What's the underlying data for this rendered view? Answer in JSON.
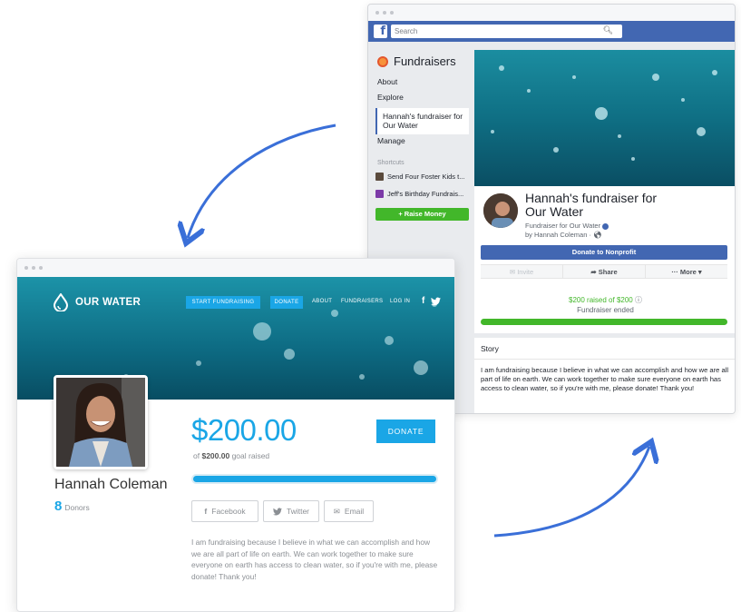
{
  "facebook": {
    "search_placeholder": "Search",
    "logo_letter": "f",
    "sidebar": {
      "title": "Fundraisers",
      "items": [
        {
          "label": "About"
        },
        {
          "label": "Explore"
        }
      ],
      "active_item": "Hannah's fundraiser for Our Water",
      "manage": "Manage",
      "shortcuts_label": "Shortcuts",
      "shortcuts": [
        {
          "label": "Send Four Foster Kids t..."
        },
        {
          "label": "Jeff's Birthday Fundrais..."
        }
      ],
      "raise_money": "+ Raise Money"
    },
    "fundraiser": {
      "title": "Hannah's fundraiser for Our Water",
      "subtitle": "Fundraiser for Our Water",
      "byline": "by Hannah Coleman · ",
      "donate_button": "Donate to Nonprofit",
      "actions": {
        "invite": "Invite",
        "share": "Share",
        "more": "More"
      },
      "raised_text": "$200 raised of $200",
      "status": "Fundraiser ended",
      "progress": 1.0
    },
    "story": {
      "heading": "Story",
      "text": "I am fundraising because I believe in what we can accomplish and how we are all part of life on earth. We can work together to make sure everyone on earth has access to clean water, so if you're with me, please donate! Thank you!"
    }
  },
  "ourwater": {
    "brand": "OUR WATER",
    "nav": {
      "start_fundraising": "START FUNDRAISING",
      "donate": "DONATE",
      "about": "ABOUT",
      "fundraisers": "FUNDRAISERS",
      "login": "LOG IN",
      "facebook_icon": "f",
      "twitter_icon": "twitter-icon"
    },
    "fundraiser": {
      "amount": "$200.00",
      "goal_prefix": "of",
      "goal_amount": "$200.00",
      "goal_suffix": "goal raised",
      "donate_button": "DONATE",
      "progress": 1.0,
      "name": "Hannah Coleman",
      "donor_count": "8",
      "donor_label": "Donors"
    },
    "share": {
      "facebook": "Facebook",
      "twitter": "Twitter",
      "email": "Email"
    },
    "story": "I am fundraising because I believe in what we can accomplish and how we are all part of life on earth. We can work together to make sure everyone on earth has access to clean water, so if you're with me, please donate! Thank you!"
  },
  "colors": {
    "facebook_blue": "#4267b2",
    "facebook_green": "#42b72a",
    "ourwater_blue": "#1aa6e6",
    "arrow_blue": "#3a6fd8"
  }
}
